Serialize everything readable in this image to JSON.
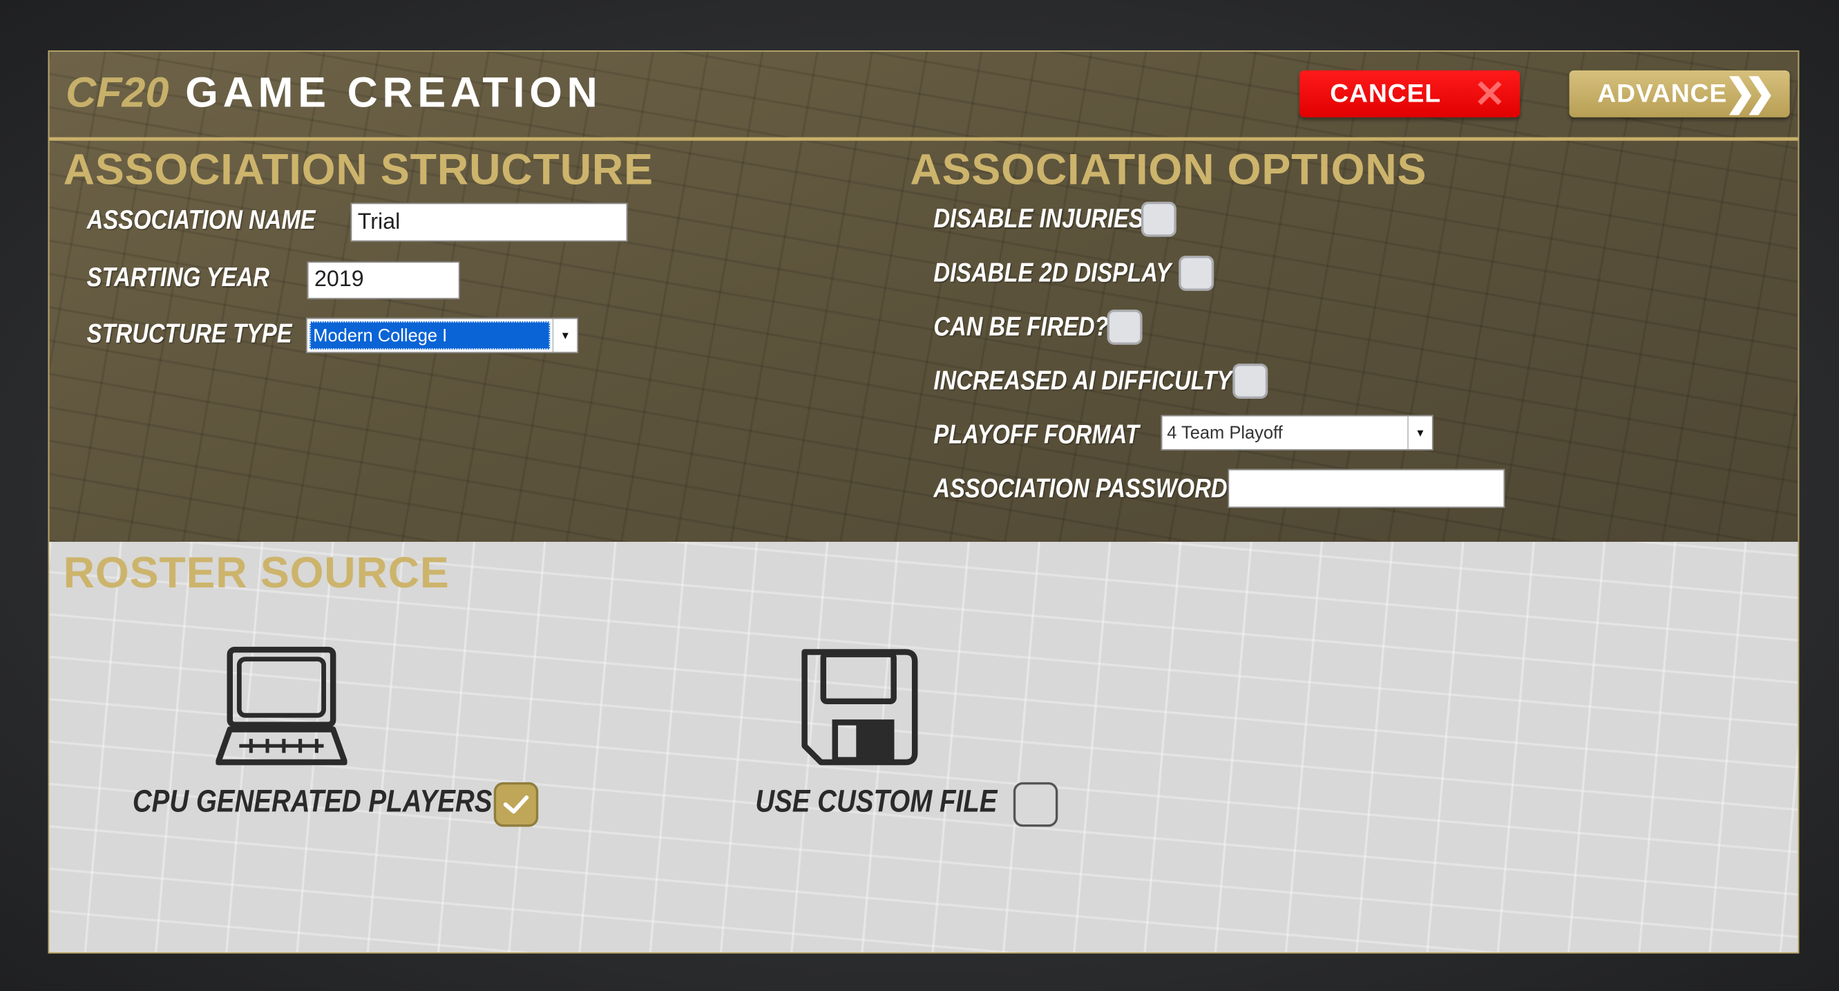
{
  "header": {
    "brand": "CF20",
    "title": "GAME CREATION",
    "cancel_label": "CANCEL",
    "cancel_icon": "x-icon",
    "advance_label": "ADVANCE",
    "advance_icon": "double-chevron-right-icon"
  },
  "structure": {
    "title": "ASSOCIATION STRUCTURE",
    "name_label": "ASSOCIATION NAME",
    "name_value": "Trial",
    "year_label": "STARTING YEAR",
    "year_value": "2019",
    "type_label": "STRUCTURE TYPE",
    "type_value": "Modern College I"
  },
  "options": {
    "title": "ASSOCIATION OPTIONS",
    "disable_injuries_label": "DISABLE INJURIES",
    "disable_injuries_checked": false,
    "disable_2d_label": "DISABLE 2D DISPLAY",
    "disable_2d_checked": false,
    "can_be_fired_label": "CAN BE FIRED?",
    "can_be_fired_checked": false,
    "increased_ai_label": "INCREASED AI DIFFICULTY",
    "increased_ai_checked": false,
    "playoff_label": "PLAYOFF FORMAT",
    "playoff_value": "4 Team Playoff",
    "password_label": "ASSOCIATION PASSWORD",
    "password_value": ""
  },
  "roster": {
    "title": "ROSTER SOURCE",
    "cpu_label": "CPU GENERATED PLAYERS",
    "cpu_checked": true,
    "cpu_icon": "laptop-icon",
    "custom_label": "USE CUSTOM FILE",
    "custom_checked": false,
    "custom_icon": "floppy-disk-icon"
  },
  "colors": {
    "accent_gold": "#cdb46c",
    "cancel_red": "#e10000",
    "selection_blue": "#0a64d6"
  }
}
